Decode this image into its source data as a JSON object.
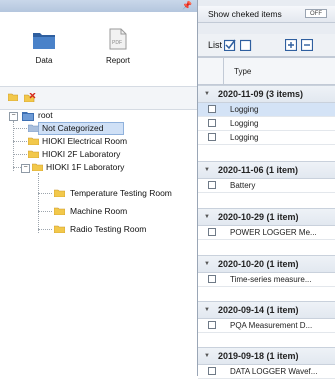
{
  "left_panel": {
    "buttons": [
      {
        "label": "Data"
      },
      {
        "label": "Report",
        "icon_text": "PDF"
      }
    ],
    "tree": {
      "root": {
        "label": "root"
      },
      "nodes": [
        {
          "label": "Not Categorized"
        },
        {
          "label": "HIOKI Electrical Room"
        },
        {
          "label": "HIOKI 2F Laboratory"
        },
        {
          "label": "HIOKI 1F Laboratory"
        },
        {
          "label": "Temperature Testing Room"
        },
        {
          "label": "Machine Room"
        },
        {
          "label": "Radio Testing Room"
        }
      ]
    }
  },
  "right_panel": {
    "show_checked": {
      "label": "Show cheked items",
      "toggle": "OFF"
    },
    "toolbar": {
      "list_label": "List"
    },
    "column_header": "Type",
    "groups": [
      {
        "header": "2020-11-09 (3 items)",
        "items": [
          "Logging",
          "Logging",
          "Logging"
        ]
      },
      {
        "header": "2020-11-06 (1 item)",
        "items": [
          "Battery"
        ]
      },
      {
        "header": "2020-10-29 (1 item)",
        "items": [
          "POWER LOGGER Me..."
        ]
      },
      {
        "header": "2020-10-20 (1 item)",
        "items": [
          "Time-series measure..."
        ]
      },
      {
        "header": "2020-09-14 (1 item)",
        "items": [
          "PQA Measurement D..."
        ]
      },
      {
        "header": "2019-09-18 (1 item)",
        "items": [
          "DATA LOGGER Wavef..."
        ]
      }
    ]
  },
  "colors": {
    "titlebar": "#b4c6de",
    "selection": "#cfe0f6",
    "folder": "#f2c84b",
    "folder_blue": "#3d6fb2"
  }
}
